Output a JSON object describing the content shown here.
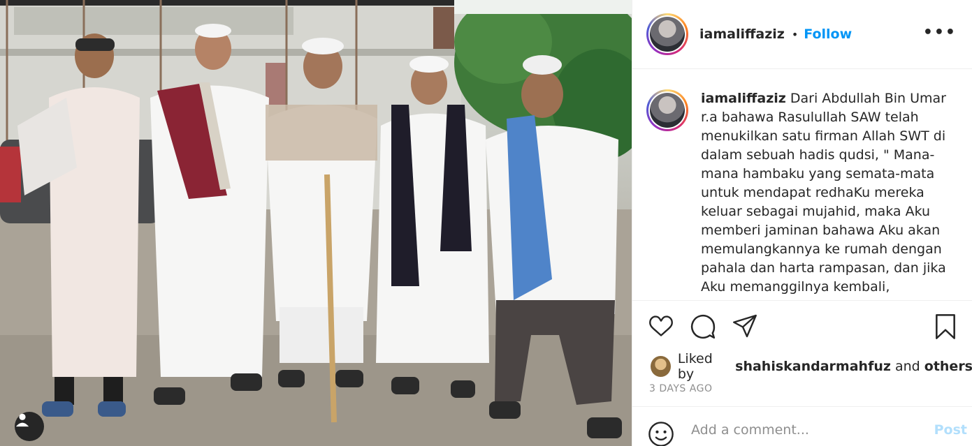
{
  "post": {
    "username": "iamaliffaziz",
    "follow_separator": "•",
    "follow_label": "Follow",
    "more_label": "•••",
    "caption_username": "iamaliffaziz",
    "caption_text": "Dari Abdullah Bin Umar r.a bahawa Rasulullah SAW telah menukilkan satu firman Allah SWT di dalam sebuah hadis qudsi, \" Mana-mana hambaku yang semata-mata untuk mendapat redhaKu mereka keluar sebagai mujahid, maka Aku memberi jaminan bahawa Aku akan memulangkannya ke rumah dengan pahala dan harta rampasan, dan jika Aku memanggilnya kembali,",
    "liked_prefix": "Liked by",
    "liked_user": "shahiskandarmahfuz",
    "liked_and": "and",
    "liked_others": "others",
    "timestamp": "3 DAYS AGO",
    "comment_placeholder": "Add a comment...",
    "post_label": "Post"
  },
  "icons": {
    "user_tag": "user-tag-icon",
    "like": "heart-icon",
    "comment": "comment-icon",
    "share": "send-icon",
    "save": "bookmark-icon",
    "emoji": "smiley-icon"
  },
  "colors": {
    "link_blue": "#0095f6",
    "post_disabled": "#b2dffc",
    "muted": "#8e8e8e",
    "text": "#262626"
  }
}
